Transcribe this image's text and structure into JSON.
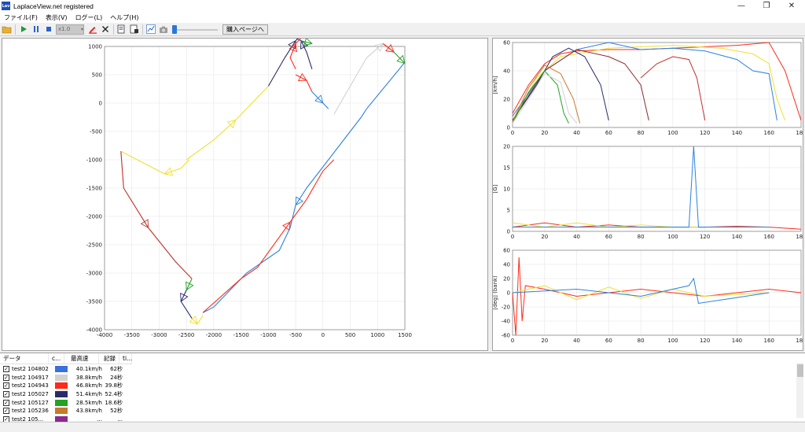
{
  "app": {
    "icon_text": "Lav",
    "title": "LaplaceView.net registered"
  },
  "window_controls": {
    "minimize": "—",
    "maximize": "❐",
    "close": "✕"
  },
  "menu": [
    "ファイル(F)",
    "表示(V)",
    "ログー(L)",
    "ヘルプ(H)"
  ],
  "toolbar": {
    "speed": "x1.0",
    "buy_label": "購入ページへ"
  },
  "colors": {
    "accent": "#2b77d8"
  },
  "table": {
    "headers": [
      "データ",
      "c...",
      "最高速",
      "記録",
      "ti..."
    ],
    "rows": [
      {
        "name": "test2 104802",
        "color": "#3a6fe0",
        "max_speed": "40.1km/h",
        "record": "62秒",
        "checked": true
      },
      {
        "name": "test2 104917",
        "color": "#d2d2d2",
        "max_speed": "38.8km/h",
        "record": "24秒",
        "checked": true
      },
      {
        "name": "test2 104943",
        "color": "#ff2a1a",
        "max_speed": "46.8km/h",
        "record": "39.8秒",
        "checked": true
      },
      {
        "name": "test2 105027",
        "color": "#2a2a6a",
        "max_speed": "51.4km/h",
        "record": "52.4秒",
        "checked": true
      },
      {
        "name": "test2 105127",
        "color": "#22a322",
        "max_speed": "28.5km/h",
        "record": "18.6秒",
        "checked": true
      },
      {
        "name": "test2 105236",
        "color": "#c77a2a",
        "max_speed": "43.8km/h",
        "record": "52秒",
        "checked": true
      },
      {
        "name": "test2 105...",
        "color": "#8a2a8a",
        "max_speed": "...",
        "record": "...",
        "checked": true
      }
    ]
  },
  "chart_data": [
    {
      "type": "line",
      "title": "",
      "xlim": [
        -4000,
        1500
      ],
      "ylim": [
        -4000,
        1000
      ],
      "x_ticks": [
        -4000,
        -3500,
        -3000,
        -2500,
        -2000,
        -1500,
        -1000,
        -500,
        0,
        500,
        1000,
        1500
      ],
      "y_ticks": [
        1000,
        500,
        0,
        -500,
        -1000,
        -1500,
        -2000,
        -2500,
        -3000,
        -3500,
        -4000
      ],
      "grid": true,
      "series": [
        {
          "color": "#2b82e0",
          "points": [
            [
              1500,
              720
            ],
            [
              800,
              -100
            ],
            [
              700,
              -250
            ],
            [
              500,
              -500
            ],
            [
              100,
              -1000
            ],
            [
              -300,
              -1500
            ],
            [
              -500,
              -1800
            ],
            [
              -600,
              -2200
            ],
            [
              -800,
              -2600
            ],
            [
              -1400,
              -3000
            ],
            [
              -2000,
              -3600
            ],
            [
              -2200,
              -3700
            ]
          ]
        },
        {
          "color": "#f0e030",
          "points": [
            [
              -2450,
              -1000
            ],
            [
              -2600,
              -1150
            ],
            [
              -2900,
              -1250
            ],
            [
              -3200,
              -1100
            ],
            [
              -3700,
              -850
            ]
          ]
        },
        {
          "color": "#f0e030",
          "points": [
            [
              -2500,
              -1000
            ],
            [
              -2000,
              -650
            ],
            [
              -1600,
              -300
            ],
            [
              -1300,
              0
            ],
            [
              -1000,
              300
            ]
          ]
        },
        {
          "color": "#2a2a6a",
          "points": [
            [
              -1000,
              300
            ],
            [
              -700,
              800
            ],
            [
              -500,
              1100
            ],
            [
              -400,
              1200
            ]
          ]
        },
        {
          "color": "#c0302a",
          "points": [
            [
              -3700,
              -850
            ],
            [
              -3650,
              -1500
            ],
            [
              -3200,
              -2200
            ],
            [
              -2700,
              -2800
            ],
            [
              -2400,
              -3100
            ]
          ]
        },
        {
          "color": "#22a322",
          "points": [
            [
              -2400,
              -3100
            ],
            [
              -2500,
              -3300
            ]
          ]
        },
        {
          "color": "#2a2a6a",
          "points": [
            [
              -2500,
              -3300
            ],
            [
              -2600,
              -3500
            ],
            [
              -2400,
              -3800
            ]
          ]
        },
        {
          "color": "#f0e030",
          "points": [
            [
              -2400,
              -3800
            ],
            [
              -2300,
              -3900
            ],
            [
              -2200,
              -3750
            ]
          ]
        },
        {
          "color": "#ff2a1a",
          "points": [
            [
              -2200,
              -3700
            ],
            [
              -1500,
              -3100
            ],
            [
              -1200,
              -2900
            ],
            [
              -600,
              -2100
            ],
            [
              -300,
              -1700
            ],
            [
              0,
              -1200
            ],
            [
              200,
              -1000
            ]
          ]
        },
        {
          "color": "#ff2a1a",
          "points": [
            [
              -500,
              500
            ],
            [
              -300,
              400
            ],
            [
              -200,
              200
            ]
          ]
        },
        {
          "color": "#2b82e0",
          "points": [
            [
              -200,
              200
            ],
            [
              0,
              0
            ],
            [
              100,
              -100
            ]
          ]
        },
        {
          "color": "#d2d2d2",
          "points": [
            [
              200,
              -200
            ],
            [
              500,
              300
            ],
            [
              800,
              800
            ],
            [
              1100,
              1050
            ],
            [
              1200,
              1000
            ],
            [
              1300,
              900
            ]
          ]
        },
        {
          "color": "#ff2a1a",
          "points": [
            [
              1100,
              1050
            ],
            [
              1300,
              900
            ]
          ]
        },
        {
          "color": "#22a322",
          "points": [
            [
              1300,
              900
            ],
            [
              1500,
              700
            ]
          ]
        },
        {
          "color": "#2a2a6a",
          "points": [
            [
              -200,
              600
            ],
            [
              -300,
              900
            ],
            [
              -400,
              1100
            ],
            [
              -500,
              1150
            ]
          ]
        },
        {
          "color": "#22a322",
          "points": [
            [
              -400,
              1100
            ],
            [
              -200,
              1050
            ]
          ]
        },
        {
          "color": "#ff2a1a",
          "points": [
            [
              -500,
              600
            ],
            [
              -600,
              800
            ],
            [
              -500,
              1050
            ],
            [
              -400,
              1150
            ]
          ]
        }
      ]
    },
    {
      "type": "line",
      "ylabel": "[km/h]",
      "xlim": [
        0,
        180
      ],
      "ylim": [
        0,
        60
      ],
      "x_ticks": [
        0,
        20,
        40,
        60,
        80,
        100,
        120,
        140,
        160,
        180
      ],
      "y_ticks": [
        0,
        20,
        40,
        60
      ],
      "grid": true,
      "series": [
        {
          "color": "#ff2a1a",
          "points": [
            [
              0,
              10
            ],
            [
              10,
              30
            ],
            [
              20,
              45
            ],
            [
              30,
              52
            ],
            [
              40,
              54
            ],
            [
              60,
              55
            ],
            [
              80,
              55
            ],
            [
              100,
              56
            ],
            [
              120,
              57
            ],
            [
              140,
              58
            ],
            [
              160,
              60
            ],
            [
              170,
              40
            ],
            [
              180,
              5
            ]
          ]
        },
        {
          "color": "#f0e030",
          "points": [
            [
              0,
              5
            ],
            [
              15,
              35
            ],
            [
              30,
              50
            ],
            [
              60,
              56
            ],
            [
              100,
              58
            ],
            [
              130,
              56
            ],
            [
              150,
              52
            ],
            [
              160,
              45
            ],
            [
              165,
              20
            ],
            [
              170,
              5
            ]
          ]
        },
        {
          "color": "#2b82e0",
          "points": [
            [
              0,
              8
            ],
            [
              20,
              40
            ],
            [
              40,
              55
            ],
            [
              60,
              60
            ],
            [
              80,
              55
            ],
            [
              100,
              56
            ],
            [
              120,
              54
            ],
            [
              140,
              48
            ],
            [
              150,
              40
            ],
            [
              160,
              38
            ],
            [
              165,
              5
            ]
          ]
        },
        {
          "color": "#8a2a2a",
          "points": [
            [
              0,
              5
            ],
            [
              20,
              40
            ],
            [
              40,
              55
            ],
            [
              60,
              50
            ],
            [
              70,
              45
            ],
            [
              80,
              30
            ],
            [
              85,
              5
            ]
          ]
        },
        {
          "color": "#2a2a6a",
          "points": [
            [
              0,
              5
            ],
            [
              15,
              30
            ],
            [
              25,
              50
            ],
            [
              35,
              56
            ],
            [
              45,
              50
            ],
            [
              55,
              30
            ],
            [
              60,
              5
            ]
          ]
        },
        {
          "color": "#22a322",
          "points": [
            [
              0,
              3
            ],
            [
              10,
              25
            ],
            [
              20,
              40
            ],
            [
              28,
              30
            ],
            [
              32,
              10
            ],
            [
              35,
              3
            ]
          ]
        },
        {
          "color": "#c77a2a",
          "points": [
            [
              0,
              4
            ],
            [
              10,
              28
            ],
            [
              20,
              44
            ],
            [
              30,
              38
            ],
            [
              38,
              20
            ],
            [
              42,
              3
            ]
          ]
        },
        {
          "color": "#d2d2d2",
          "points": [
            [
              0,
              3
            ],
            [
              10,
              20
            ],
            [
              20,
              38
            ],
            [
              30,
              32
            ],
            [
              35,
              10
            ],
            [
              40,
              3
            ]
          ]
        },
        {
          "color": "#c0302a",
          "points": [
            [
              80,
              35
            ],
            [
              90,
              45
            ],
            [
              100,
              50
            ],
            [
              110,
              48
            ],
            [
              115,
              35
            ],
            [
              120,
              5
            ]
          ]
        }
      ]
    },
    {
      "type": "line",
      "ylabel": "[G]",
      "xlim": [
        0,
        180
      ],
      "ylim": [
        0,
        20
      ],
      "x_ticks": [
        0,
        20,
        40,
        60,
        80,
        100,
        120,
        140,
        160,
        180
      ],
      "y_ticks": [
        0,
        5,
        10,
        15,
        20
      ],
      "grid": true,
      "series": [
        {
          "color": "#ff2a1a",
          "points": [
            [
              0,
              1
            ],
            [
              20,
              2
            ],
            [
              40,
              1
            ],
            [
              60,
              1.5
            ],
            [
              80,
              1
            ],
            [
              100,
              1
            ],
            [
              120,
              1
            ],
            [
              140,
              1.2
            ],
            [
              160,
              1
            ],
            [
              180,
              0.5
            ]
          ]
        },
        {
          "color": "#f0e030",
          "points": [
            [
              0,
              2
            ],
            [
              20,
              1
            ],
            [
              40,
              2
            ],
            [
              60,
              1
            ],
            [
              80,
              1.5
            ],
            [
              100,
              1
            ],
            [
              120,
              1
            ],
            [
              140,
              1
            ],
            [
              160,
              1
            ]
          ]
        },
        {
          "color": "#2b82e0",
          "points": [
            [
              0,
              1
            ],
            [
              40,
              1
            ],
            [
              80,
              1
            ],
            [
              110,
              1
            ],
            [
              113,
              20
            ],
            [
              116,
              1
            ],
            [
              160,
              1
            ]
          ]
        }
      ]
    },
    {
      "type": "line",
      "ylabel": "[deg] (bank)",
      "xlim": [
        0,
        180
      ],
      "ylim": [
        -60,
        60
      ],
      "x_ticks": [
        0,
        20,
        40,
        60,
        80,
        100,
        120,
        140,
        160,
        180
      ],
      "y_ticks": [
        -60,
        -40,
        -20,
        0,
        20,
        40,
        60
      ],
      "grid": true,
      "series": [
        {
          "color": "#ff2a1a",
          "points": [
            [
              0,
              0
            ],
            [
              2,
              -60
            ],
            [
              4,
              50
            ],
            [
              6,
              -40
            ],
            [
              8,
              10
            ],
            [
              20,
              5
            ],
            [
              40,
              -5
            ],
            [
              80,
              5
            ],
            [
              120,
              -5
            ],
            [
              160,
              5
            ],
            [
              180,
              0
            ]
          ]
        },
        {
          "color": "#f0e030",
          "points": [
            [
              0,
              0
            ],
            [
              20,
              10
            ],
            [
              40,
              -10
            ],
            [
              60,
              8
            ],
            [
              80,
              -8
            ],
            [
              100,
              5
            ],
            [
              120,
              -5
            ],
            [
              160,
              0
            ]
          ]
        },
        {
          "color": "#2b82e0",
          "points": [
            [
              0,
              0
            ],
            [
              40,
              5
            ],
            [
              80,
              -5
            ],
            [
              110,
              10
            ],
            [
              113,
              20
            ],
            [
              116,
              -15
            ],
            [
              160,
              0
            ]
          ]
        }
      ]
    }
  ]
}
